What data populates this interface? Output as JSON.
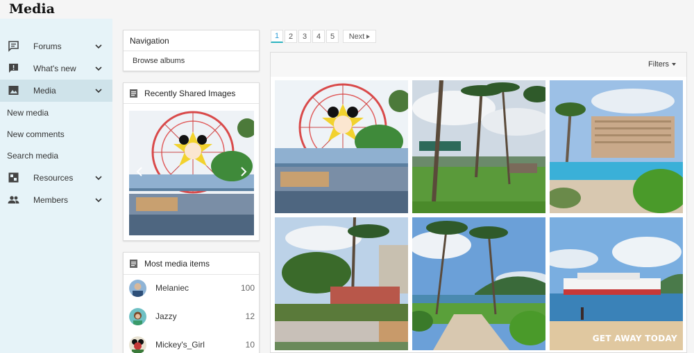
{
  "page": {
    "title": "Media"
  },
  "sidebar": {
    "items": [
      {
        "label": "Forums",
        "icon": "forums-icon"
      },
      {
        "label": "What's new",
        "icon": "whats-new-icon"
      },
      {
        "label": "Media",
        "icon": "media-icon",
        "active": true
      },
      {
        "label": "Resources",
        "icon": "resources-icon"
      },
      {
        "label": "Members",
        "icon": "members-icon"
      }
    ],
    "media_sub": [
      "New media",
      "New comments",
      "Search media"
    ]
  },
  "widgets": {
    "navigation": {
      "title": "Navigation",
      "link": "Browse albums"
    },
    "recent": {
      "title": "Recently Shared Images"
    },
    "most": {
      "title": "Most media items",
      "members": [
        {
          "name": "Melaniec",
          "count": "100"
        },
        {
          "name": "Jazzy",
          "count": "12"
        },
        {
          "name": "Mickey's_Girl",
          "count": "10"
        }
      ]
    }
  },
  "pagination": {
    "pages": [
      "1",
      "2",
      "3",
      "4",
      "5"
    ],
    "current": "1",
    "next": "Next"
  },
  "media": {
    "filters": "Filters",
    "thumbs": [
      {
        "icon": "ferris-wheel-thumbnail"
      },
      {
        "icon": "palm-trees-thumbnail"
      },
      {
        "icon": "resort-pool-thumbnail"
      },
      {
        "icon": "hotel-garden-thumbnail"
      },
      {
        "icon": "beach-path-thumbnail"
      },
      {
        "icon": "cruise-ship-thumbnail",
        "caption": "GET AWAY TODAY"
      }
    ]
  },
  "colors": {
    "sidebar_bg": "#e6f3f8",
    "active_bg": "#cfe3ea",
    "accent": "#2bb3c0"
  }
}
